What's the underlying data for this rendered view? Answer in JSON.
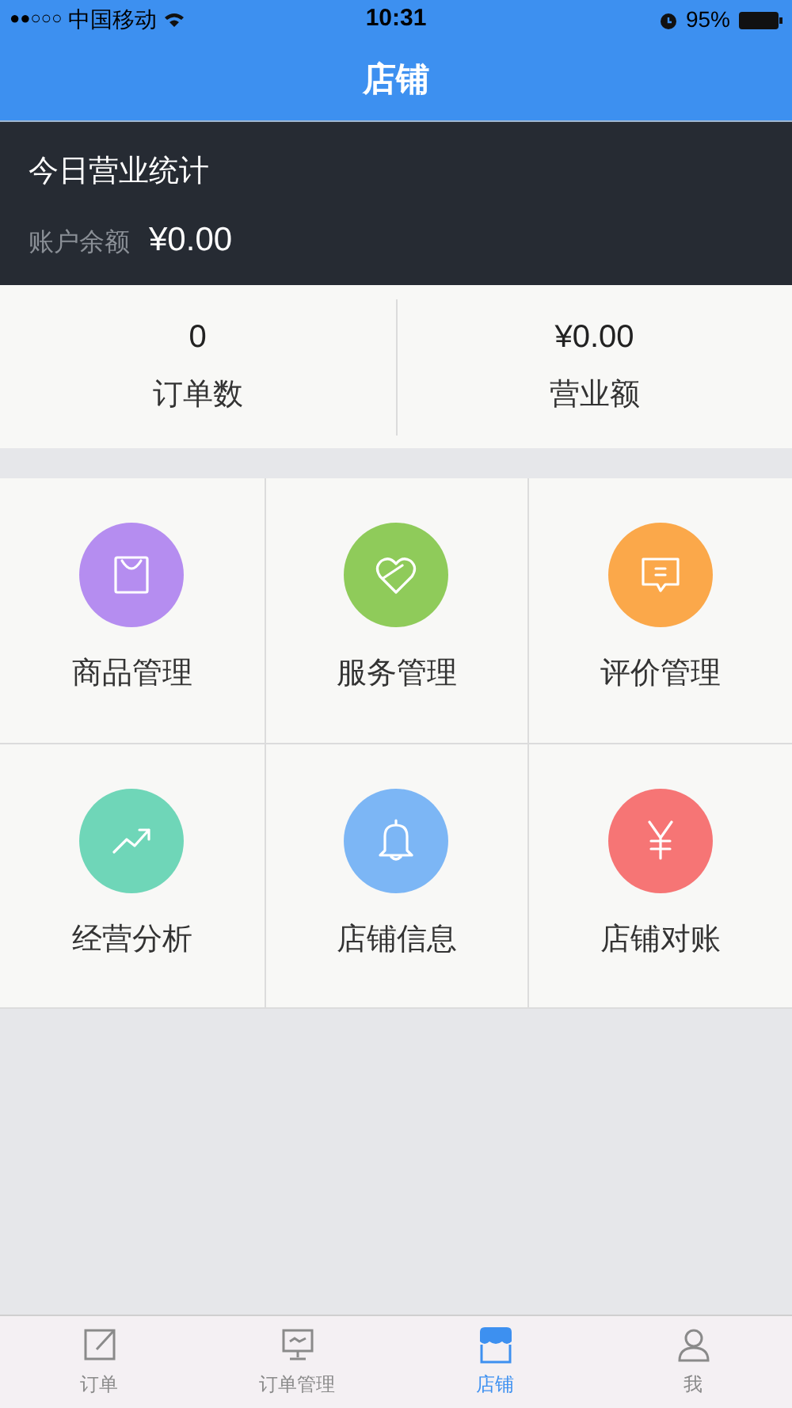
{
  "status_bar": {
    "signal": "●●○○○",
    "carrier": "中国移动",
    "time": "10:31",
    "battery": "95%"
  },
  "nav": {
    "title": "店铺"
  },
  "summary": {
    "title": "今日营业统计",
    "balance_label": "账户余额",
    "balance": "¥0.00"
  },
  "stats": [
    {
      "value": "0",
      "label": "订单数"
    },
    {
      "value": "¥0.00",
      "label": "营业额"
    }
  ],
  "menu": [
    {
      "kind": "bag",
      "label": "商品管理",
      "color": "#b58df0"
    },
    {
      "kind": "heart",
      "label": "服务管理",
      "color": "#8fcb5a"
    },
    {
      "kind": "chat",
      "label": "评价管理",
      "color": "#fba84a"
    },
    {
      "kind": "trend",
      "label": "经营分析",
      "color": "#6fd6b8"
    },
    {
      "kind": "bell",
      "label": "店铺信息",
      "color": "#7cb6f5"
    },
    {
      "kind": "yen",
      "label": "店铺对账",
      "color": "#f67575"
    }
  ],
  "tab_bar": [
    {
      "kind": "edit",
      "label": "订单",
      "selected": false
    },
    {
      "kind": "monitor",
      "label": "订单管理",
      "selected": false
    },
    {
      "kind": "shop",
      "label": "店铺",
      "selected": true
    },
    {
      "kind": "person",
      "label": "我",
      "selected": false
    }
  ]
}
